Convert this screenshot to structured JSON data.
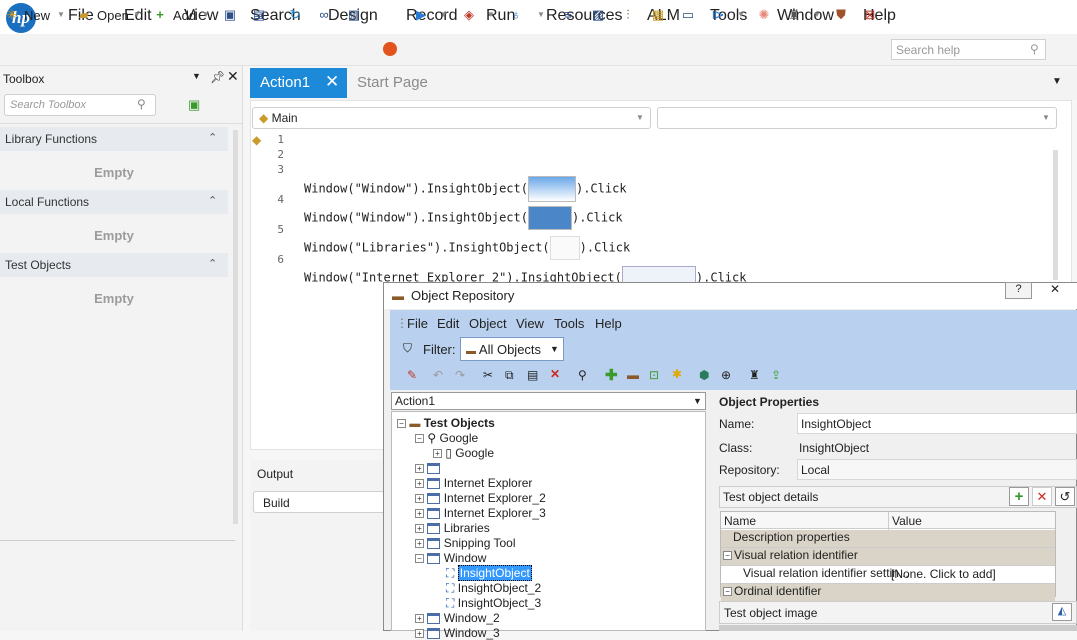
{
  "menubar": {
    "logo": "hp",
    "items": [
      "File",
      "Edit",
      "View",
      "Search",
      "Design",
      "Record",
      "Run",
      "Resources",
      "ALM",
      "Tools",
      "Window",
      "Help"
    ]
  },
  "toolbar": {
    "new_label": "New",
    "open_label": "Open",
    "add_label": "Add",
    "search_placeholder": "Search help"
  },
  "toolbox": {
    "title": "Toolbox",
    "search_placeholder": "Search Toolbox",
    "sections": [
      {
        "label": "Library Functions",
        "state": "Empty"
      },
      {
        "label": "Local Functions",
        "state": "Empty"
      },
      {
        "label": "Test Objects",
        "state": "Empty"
      }
    ]
  },
  "editor": {
    "tabs": [
      "Action1",
      "Start Page"
    ],
    "combo_main": "Main",
    "line_numbers": [
      "1",
      "2",
      "3",
      "4",
      "5",
      "6"
    ],
    "lines": [
      {
        "pre": "Window(\"Window\").InsightObject(",
        "post": ").Click"
      },
      {
        "pre": "Window(\"Window\").InsightObject(",
        "post": ").Click"
      },
      {
        "pre": "Window(\"Libraries\").InsightObject(",
        "post": ").Click"
      },
      {
        "pre": "Window(\"Internet Explorer_2\").InsightObject(",
        "post": ").Click"
      }
    ]
  },
  "output": {
    "title": "Output",
    "build_label": "Build"
  },
  "object_repository": {
    "title": "Object Repository",
    "menu": [
      "File",
      "Edit",
      "Object",
      "View",
      "Tools",
      "Help"
    ],
    "filter_label": "Filter:",
    "filter_value": "All Objects",
    "action_select": "Action1",
    "tree": [
      {
        "label": "Test Objects",
        "level": 0,
        "bold": true
      },
      {
        "label": "Google",
        "level": 1
      },
      {
        "label": "Google",
        "level": 2
      },
      {
        "label": "",
        "level": 1
      },
      {
        "label": "Internet Explorer",
        "level": 1
      },
      {
        "label": "Internet Explorer_2",
        "level": 1
      },
      {
        "label": "Internet Explorer_3",
        "level": 1
      },
      {
        "label": "Libraries",
        "level": 1
      },
      {
        "label": "Snipping Tool",
        "level": 1
      },
      {
        "label": "Window",
        "level": 1
      },
      {
        "label": "InsightObject",
        "level": 2,
        "selected": true
      },
      {
        "label": "InsightObject_2",
        "level": 2
      },
      {
        "label": "InsightObject_3",
        "level": 2
      },
      {
        "label": "Window_2",
        "level": 1
      },
      {
        "label": "Window_3",
        "level": 1
      }
    ],
    "properties": {
      "title": "Object Properties",
      "name_label": "Name:",
      "name_value": "InsightObject",
      "class_label": "Class:",
      "class_value": "InsightObject",
      "repo_label": "Repository:",
      "repo_value": "Local",
      "details_title": "Test object details",
      "col_name": "Name",
      "col_value": "Value",
      "rows": [
        {
          "name": "Description properties",
          "value": ""
        },
        {
          "name": "Visual relation identifier",
          "value": ""
        },
        {
          "name": "Visual relation identifier settin...",
          "value": "[None. Click to add]"
        },
        {
          "name": "Ordinal identifier",
          "value": ""
        }
      ],
      "image_title": "Test object image"
    }
  },
  "colors": {
    "accent": "#1c8ad9",
    "or_band": "#b9d1ef",
    "selected": "#3399ff"
  }
}
